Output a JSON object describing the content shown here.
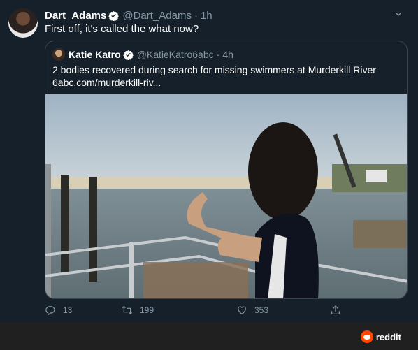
{
  "tweet": {
    "author_name": "Dart_Adams",
    "author_handle": "@Dart_Adams",
    "separator": "·",
    "time": "1h",
    "text": "First off, it's called the what now?"
  },
  "quoted": {
    "author_name": "Katie Katro",
    "author_handle": "@KatieKatro6abc",
    "separator": "·",
    "time": "4h",
    "text_line1": "2 bodies recovered during search for missing swimmers at Murderkill River",
    "text_line2": "6abc.com/murderkill-riv..."
  },
  "actions": {
    "reply_count": "13",
    "retweet_count": "199",
    "like_count": "353"
  },
  "watermark": {
    "label": "reddit"
  },
  "icons": {
    "verified": "verified-badge-icon",
    "caret": "chevron-down-icon",
    "reply": "reply-icon",
    "retweet": "retweet-icon",
    "like": "heart-icon",
    "share": "share-icon",
    "reddit": "reddit-logo-icon"
  },
  "colors": {
    "background": "#15202b",
    "muted": "#8899a6",
    "border": "#38444d",
    "verified": "#ffffff",
    "reddit_orange": "#ff4500",
    "bar": "#202020"
  }
}
